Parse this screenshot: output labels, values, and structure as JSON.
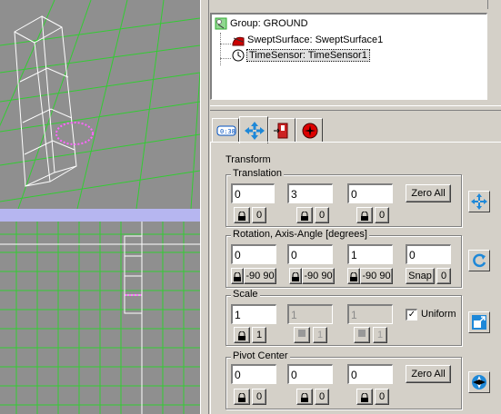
{
  "scene_tree": {
    "root": "Group:  GROUND",
    "children": [
      "SweptSurface:  SweptSurface1",
      "TimeSensor:  TimeSensor1"
    ]
  },
  "tabs": [
    {
      "icon": "time-sensor-tab-icon"
    },
    {
      "icon": "move-tab-icon"
    },
    {
      "icon": "exit-door-tab-icon"
    },
    {
      "icon": "red-burst-tab-icon"
    }
  ],
  "panel": {
    "title": "Transform",
    "translation": {
      "label": "Translation",
      "values": [
        "0",
        "3",
        "0"
      ],
      "zero_all": "Zero All",
      "lock_zero": "0"
    },
    "rotation": {
      "label": "Rotation, Axis-Angle  [degrees]",
      "values": [
        "0",
        "0",
        "1",
        "0"
      ],
      "step": "-90 90",
      "snap": "Snap",
      "snap_zero": "0"
    },
    "scale": {
      "label": "Scale",
      "values": [
        "1",
        "1",
        "1"
      ],
      "one": "1",
      "uniform": "Uniform",
      "uniform_checked": true
    },
    "pivot": {
      "label": "Pivot Center",
      "values": [
        "0",
        "0",
        "0"
      ],
      "zero_all": "Zero All",
      "lock_zero": "0"
    }
  },
  "colors": {
    "viewport_bg": "#8f8f8f",
    "grid": "#33cc33",
    "wire": "#ffffff",
    "highlight": "#ff66ff"
  }
}
